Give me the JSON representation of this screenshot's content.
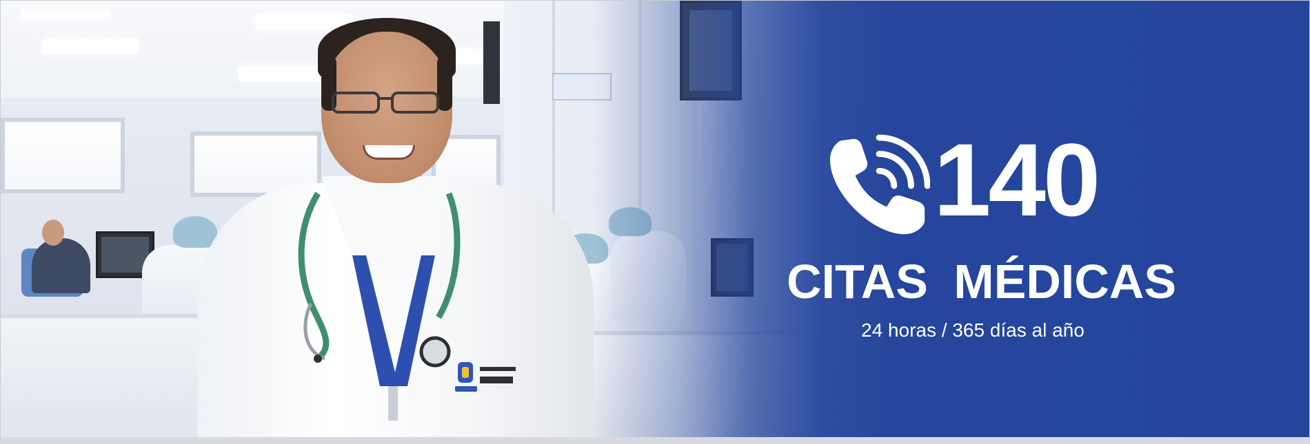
{
  "banner": {
    "phone_number": "140",
    "title": "CITAS MÉDICAS",
    "subtitle": "24 horas / 365 días al año",
    "icons": {
      "phone": "phone-icon"
    },
    "colors": {
      "brand_blue": "#24459b",
      "text": "#ffffff"
    }
  }
}
